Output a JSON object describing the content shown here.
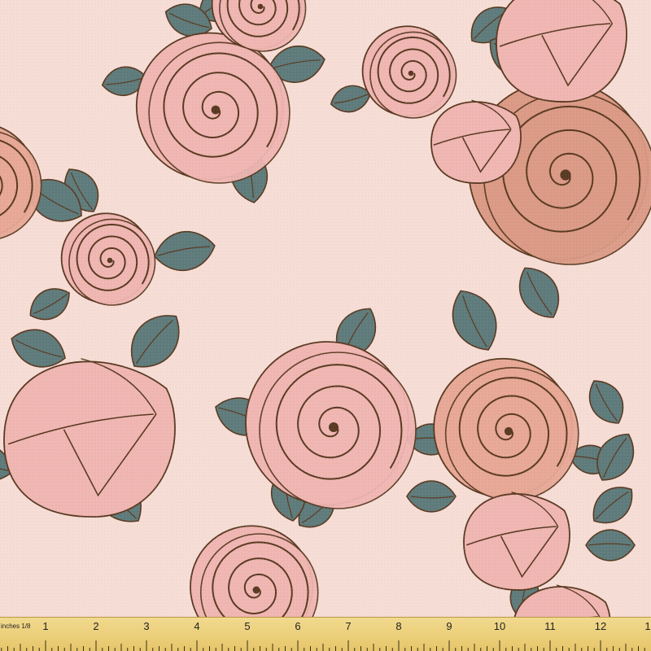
{
  "image": {
    "description_kind": "fabric swatch with rose print",
    "colors": {
      "background": "#f6ddd5",
      "leaf": "#5f7b7b",
      "outline": "#5a3a22",
      "rose_light": "#f0b6b2",
      "rose_peach": "#e8a896",
      "rose_dark": "#db9a85"
    }
  },
  "ruler": {
    "unit_label": "inches 1/8",
    "numbers": [
      "1",
      "2",
      "3",
      "4",
      "5",
      "6",
      "7",
      "8",
      "9",
      "10",
      "11",
      "12",
      "1"
    ]
  }
}
